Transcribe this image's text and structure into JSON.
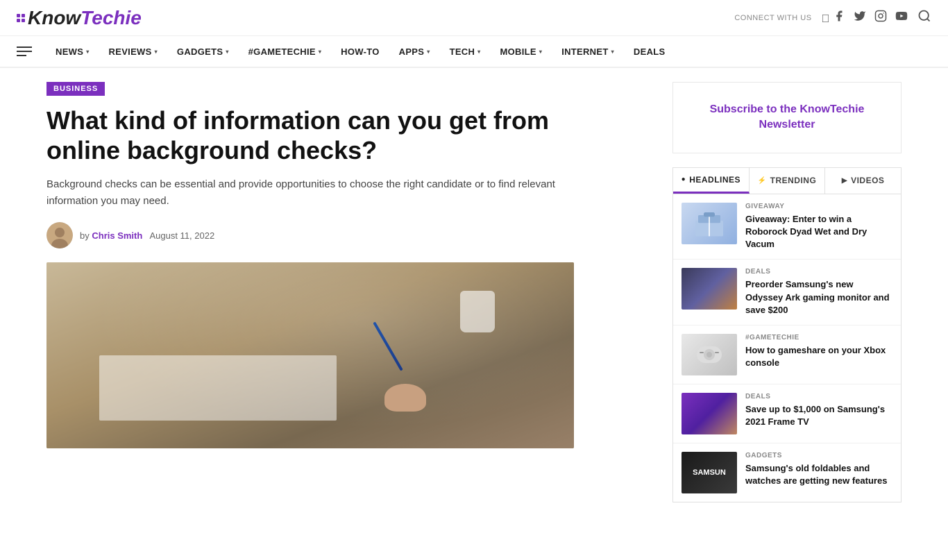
{
  "header": {
    "logo_know": "Know",
    "logo_techie": "Techie",
    "connect_label": "CONNECT WITH US",
    "search_label": "search"
  },
  "nav": {
    "items": [
      {
        "label": "NEWS",
        "has_arrow": true
      },
      {
        "label": "REVIEWS",
        "has_arrow": true
      },
      {
        "label": "GADGETS",
        "has_arrow": true
      },
      {
        "label": "#GAMETECHIE",
        "has_arrow": true
      },
      {
        "label": "HOW-TO",
        "has_arrow": false
      },
      {
        "label": "APPS",
        "has_arrow": true
      },
      {
        "label": "TECH",
        "has_arrow": true
      },
      {
        "label": "MOBILE",
        "has_arrow": true
      },
      {
        "label": "INTERNET",
        "has_arrow": true
      },
      {
        "label": "DEALS",
        "has_arrow": false
      }
    ]
  },
  "article": {
    "category": "BUSINESS",
    "title": "What kind of information can you get from online background checks?",
    "subtitle": "Background checks can be essential and provide opportunities to choose the right candidate or to find relevant information you may need.",
    "author_by": "by",
    "author_name": "Chris Smith",
    "date": "August 11, 2022"
  },
  "sidebar": {
    "newsletter_title": "Subscribe to the KnowTechie Newsletter",
    "tabs": [
      {
        "label": "HEADLINES",
        "icon": "●",
        "active": true
      },
      {
        "label": "TRENDING",
        "icon": "⚡",
        "active": false
      },
      {
        "label": "VIDEOS",
        "icon": "▶",
        "active": false
      }
    ],
    "news_items": [
      {
        "category": "GIVEAWAY",
        "title": "Giveaway: Enter to win a Roborock Dyad Wet and Dry Vacum",
        "thumb_type": "giveaway"
      },
      {
        "category": "DEALS",
        "title": "Preorder Samsung's new Odyssey Ark gaming monitor and save $200",
        "thumb_type": "deals"
      },
      {
        "category": "#GAMETECHIE",
        "title": "How to gameshare on your Xbox console",
        "thumb_type": "xbox"
      },
      {
        "category": "DEALS",
        "title": "Save up to $1,000 on Samsung's 2021 Frame TV",
        "thumb_type": "samsung"
      },
      {
        "category": "GADGETS",
        "title": "Samsung's old foldables and watches are getting new features",
        "thumb_type": "foldable"
      }
    ]
  }
}
